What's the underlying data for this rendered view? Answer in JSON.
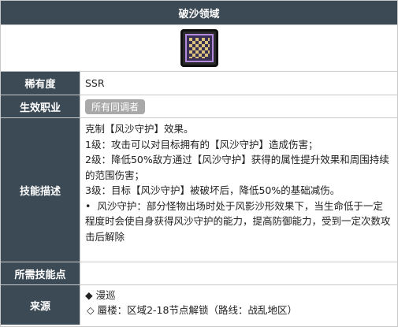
{
  "title": "破沙领域",
  "icon": {
    "name": "sand-domain-skill-icon",
    "frame_color": "#111111",
    "grid_color": "#d9c37a",
    "dot_color": "#b48ae0"
  },
  "rows": {
    "rarity": {
      "label": "稀有度",
      "value": "SSR"
    },
    "class": {
      "label": "生效职业",
      "badge": "所有同调者"
    },
    "description": {
      "label": "技能描述",
      "lines": [
        "克制【风沙守护】效果。",
        "1级：攻击可以对目标拥有的【风沙守护】造成伤害；",
        "2级：降低50%敌方通过【风沙守护】获得的属性提升效果和周围持续的范围伤害；",
        "3级：目标【风沙守护】被破坏后，降低50%的基础减伤。"
      ],
      "bullet": "风沙守护：部分怪物出场时处于风影沙形效果下，当生命低于一定程度时会使自身获得风沙守护的能力，提高防御能力，受到一定次数攻击后解除"
    },
    "points": {
      "label": "所需技能点",
      "value": ""
    },
    "source": {
      "label": "来源",
      "main": "漫巡",
      "sub": "蜃楼：区域2-18节点解锁（路线：战乱地区）"
    }
  },
  "colors": {
    "header_bg": "#3c4a55",
    "badge_bg": "#a9a9a9",
    "border": "#c9c9c9"
  }
}
